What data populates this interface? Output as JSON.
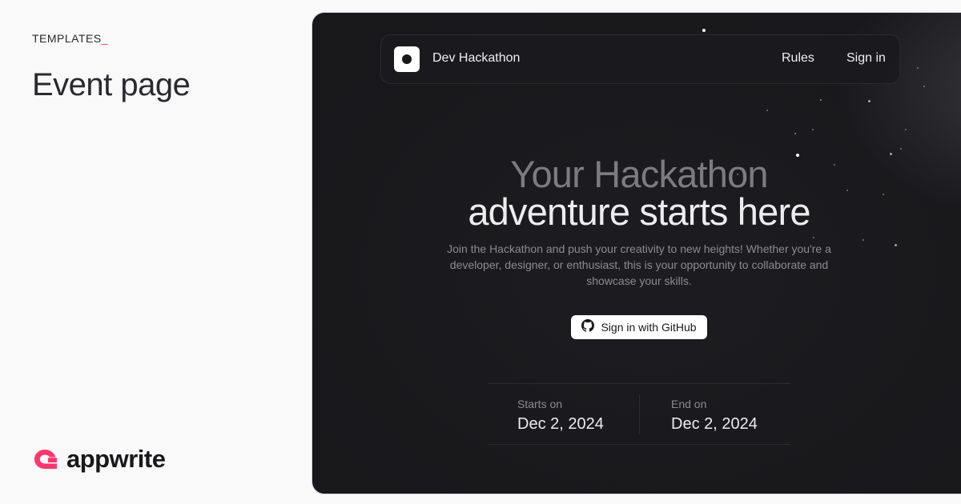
{
  "left": {
    "kicker": "TEMPLATES",
    "kicker_cursor": "_",
    "title": "Event page",
    "brand": {
      "name": "appwrite",
      "logo_icon": "appwrite-logo-icon",
      "accent": "#fd366e"
    }
  },
  "preview": {
    "nav": {
      "logo_icon": "app-logo-icon",
      "title": "Dev Hackathon",
      "links": [
        "Rules",
        "Sign in"
      ]
    },
    "hero": {
      "line1": "Your Hackathon",
      "line2": "adventure starts here",
      "subtitle": "Join the Hackathon and push your creativity to new heights! Whether you're a developer, designer, or enthusiast, this is your opportunity to collaborate and showcase your skills.",
      "cta_label": "Sign in with GitHub",
      "cta_icon": "github-icon"
    },
    "dates": {
      "start_label": "Starts on",
      "start_value": "Dec 2, 2024",
      "end_label": "End on",
      "end_value": "Dec 2, 2024"
    },
    "colors": {
      "background": "#18181b",
      "text_primary": "#ededef",
      "text_muted": "#8b8b90"
    }
  }
}
